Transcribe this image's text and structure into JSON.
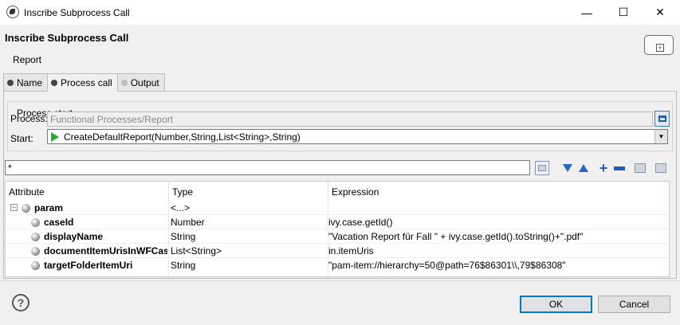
{
  "window": {
    "title": "Inscribe Subprocess Call",
    "controls": {
      "minimize": "—",
      "maximize": "☐",
      "close": "✕"
    }
  },
  "header": {
    "title": "Inscribe Subprocess Call",
    "subtitle": "Report"
  },
  "tabs": [
    {
      "label": "Name",
      "active": false
    },
    {
      "label": "Process call",
      "active": true
    },
    {
      "label": "Output",
      "active": false
    }
  ],
  "process_start": {
    "group_title": "Process start",
    "process_label": "Process:",
    "process_value": "Functional Processes/Report",
    "start_label": "Start:",
    "start_value": "CreateDefaultReport(Number,String,List<String>,String)"
  },
  "filter": {
    "value": "*"
  },
  "table": {
    "headers": [
      "Attribute",
      "Type",
      "Expression"
    ],
    "root": {
      "name": "param",
      "type": "<...>",
      "expression": "",
      "toggle": "−"
    },
    "rows": [
      {
        "name": "caseId",
        "type": "Number",
        "expression": "ivy.case.getId()"
      },
      {
        "name": "displayName",
        "type": "String",
        "expression": "\"Vacation Report für Fall \" + ivy.case.getId().toString()+\".pdf\""
      },
      {
        "name": "documentItemUrisInWFCase",
        "type": "List<String>",
        "expression": "in.itemUris"
      },
      {
        "name": "targetFolderItemUri",
        "type": "String",
        "expression": "\"pam-item://hierarchy=50@path=76$86301\\\\,79$86308\""
      }
    ]
  },
  "footer": {
    "help": "?",
    "ok_label": "OK",
    "cancel_label": "Cancel"
  }
}
